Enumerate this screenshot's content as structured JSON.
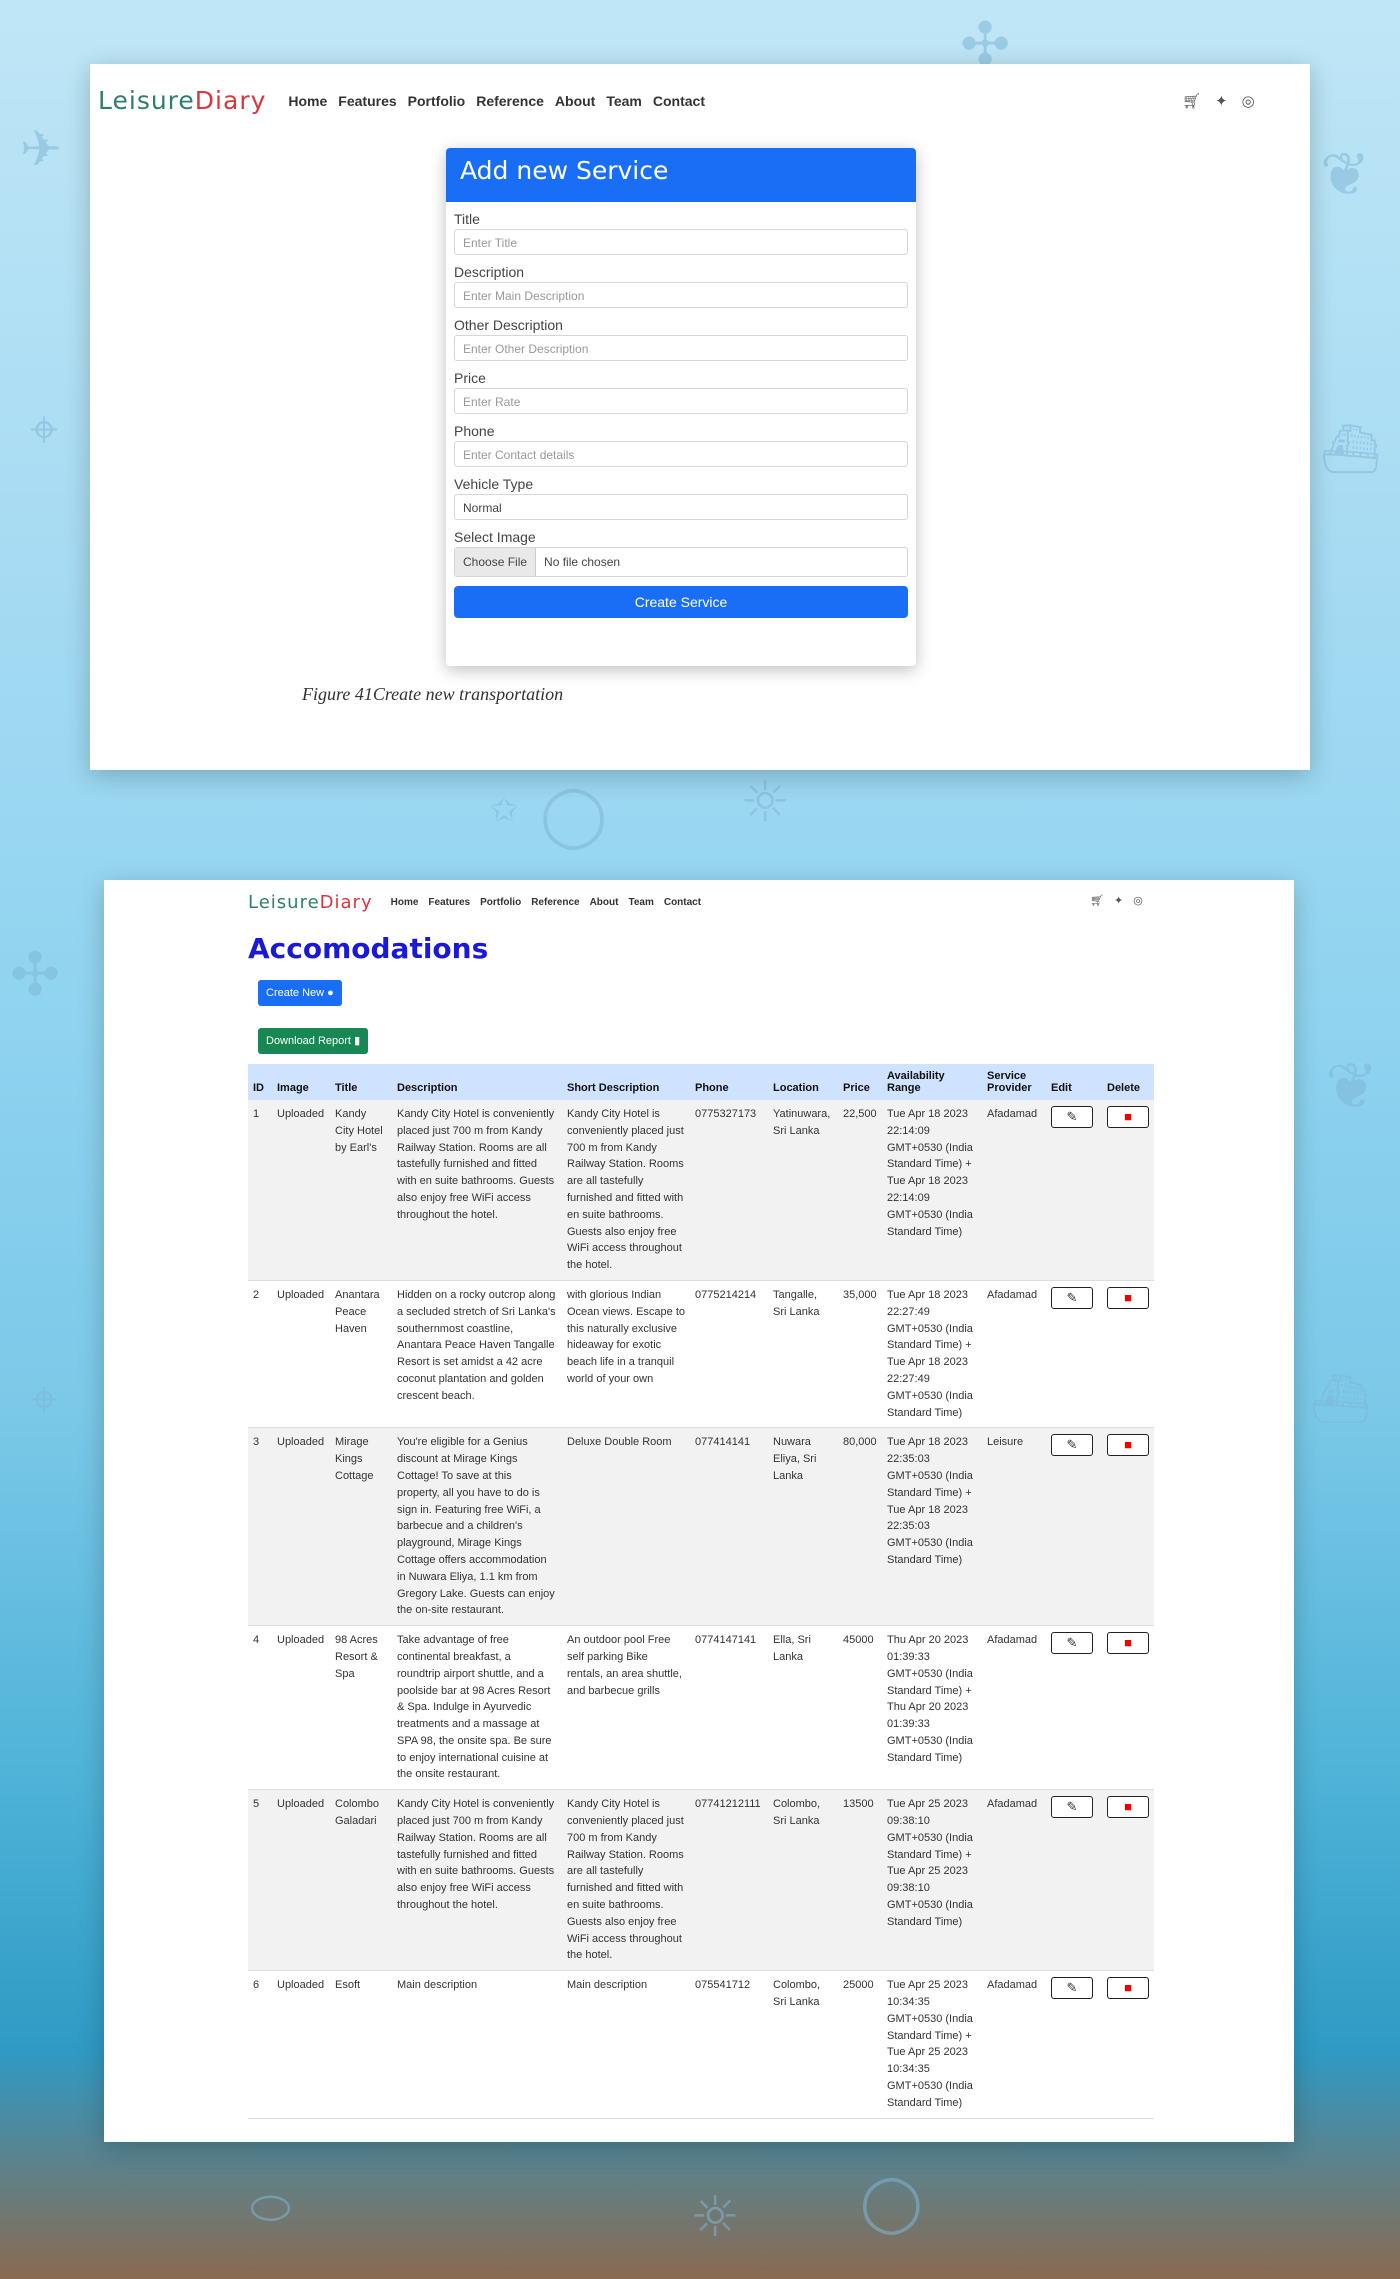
{
  "brand": {
    "part1": "Leisure",
    "part2": "Diary"
  },
  "nav": [
    "Home",
    "Features",
    "Portfolio",
    "Reference",
    "About",
    "Team",
    "Contact"
  ],
  "nav_icons": [
    "cart-icon",
    "twitter-icon",
    "instagram-icon"
  ],
  "form": {
    "title": "Add new Service",
    "fields": [
      {
        "label": "Title",
        "placeholder": "Enter Title"
      },
      {
        "label": "Description",
        "placeholder": "Enter Main Description"
      },
      {
        "label": "Other Description",
        "placeholder": "Enter Other Description"
      },
      {
        "label": "Price",
        "placeholder": "Enter Rate"
      },
      {
        "label": "Phone",
        "placeholder": "Enter Contact details"
      },
      {
        "label": "Vehicle Type",
        "value": "Normal"
      }
    ],
    "image_label": "Select Image",
    "choose_file": "Choose File",
    "no_file": "No file chosen",
    "submit": "Create Service"
  },
  "caption": "Figure 41Create new transportation",
  "accommodations": {
    "title": "Accomodations",
    "create_new": "Create New",
    "download_report": "Download Report",
    "columns": [
      "ID",
      "Image",
      "Title",
      "Description",
      "Short Description",
      "Phone",
      "Location",
      "Price",
      "Availability Range",
      "Service Provider",
      "Edit",
      "Delete"
    ],
    "rows": [
      {
        "id": "1",
        "image": "Uploaded",
        "title": "Kandy City Hotel by Earl's",
        "description": "Kandy City Hotel is conveniently placed just 700 m from Kandy Railway Station. Rooms are all tastefully furnished and fitted with en suite bathrooms. Guests also enjoy free WiFi access throughout the hotel.",
        "short": "Kandy City Hotel is conveniently placed just 700 m from Kandy Railway Station. Rooms are all tastefully furnished and fitted with en suite bathrooms. Guests also enjoy free WiFi access throughout the hotel.",
        "phone": "0775327173",
        "location": "Yatinuwara, Sri Lanka",
        "price": "22,500",
        "range": "Tue Apr 18 2023 22:14:09 GMT+0530 (India Standard Time) + Tue Apr 18 2023 22:14:09 GMT+0530 (India Standard Time)",
        "provider": "Afadamad"
      },
      {
        "id": "2",
        "image": "Uploaded",
        "title": "Anantara Peace Haven",
        "description": "Hidden on a rocky outcrop along a secluded stretch of Sri Lanka's southernmost coastline, Anantara Peace Haven Tangalle Resort is set amidst a 42 acre coconut plantation and golden crescent beach.",
        "short": "with glorious Indian Ocean views. Escape to this naturally exclusive hideaway for exotic beach life in a tranquil world of your own",
        "phone": "0775214214",
        "location": "Tangalle, Sri Lanka",
        "price": "35,000",
        "range": "Tue Apr 18 2023 22:27:49 GMT+0530 (India Standard Time) + Tue Apr 18 2023 22:27:49 GMT+0530 (India Standard Time)",
        "provider": "Afadamad"
      },
      {
        "id": "3",
        "image": "Uploaded",
        "title": "Mirage Kings Cottage",
        "description": "You're eligible for a Genius discount at Mirage Kings Cottage! To save at this property, all you have to do is sign in. Featuring free WiFi, a barbecue and a children's playground, Mirage Kings Cottage offers accommodation in Nuwara Eliya, 1.1 km from Gregory Lake. Guests can enjoy the on-site restaurant.",
        "short": "Deluxe Double Room",
        "phone": "077414141",
        "location": "Nuwara Eliya, Sri Lanka",
        "price": "80,000",
        "range": "Tue Apr 18 2023 22:35:03 GMT+0530 (India Standard Time) + Tue Apr 18 2023 22:35:03 GMT+0530 (India Standard Time)",
        "provider": "Leisure"
      },
      {
        "id": "4",
        "image": "Uploaded",
        "title": "98 Acres Resort & Spa",
        "description": "Take advantage of free continental breakfast, a roundtrip airport shuttle, and a poolside bar at 98 Acres Resort & Spa. Indulge in Ayurvedic treatments and a massage at SPA 98, the onsite spa. Be sure to enjoy international cuisine at the onsite restaurant.",
        "short": "An outdoor pool Free self parking Bike rentals, an area shuttle, and barbecue grills",
        "phone": "0774147141",
        "location": "Ella, Sri Lanka",
        "price": "45000",
        "range": "Thu Apr 20 2023 01:39:33 GMT+0530 (India Standard Time) + Thu Apr 20 2023 01:39:33 GMT+0530 (India Standard Time)",
        "provider": "Afadamad"
      },
      {
        "id": "5",
        "image": "Uploaded",
        "title": "Colombo Galadari",
        "description": "Kandy City Hotel is conveniently placed just 700 m from Kandy Railway Station. Rooms are all tastefully furnished and fitted with en suite bathrooms. Guests also enjoy free WiFi access throughout the hotel.",
        "short": "Kandy City Hotel is conveniently placed just 700 m from Kandy Railway Station. Rooms are all tastefully furnished and fitted with en suite bathrooms. Guests also enjoy free WiFi access throughout the hotel.",
        "phone": "07741212111",
        "location": "Colombo, Sri Lanka",
        "price": "13500",
        "range": "Tue Apr 25 2023 09:38:10 GMT+0530 (India Standard Time) + Tue Apr 25 2023 09:38:10 GMT+0530 (India Standard Time)",
        "provider": "Afadamad"
      },
      {
        "id": "6",
        "image": "Uploaded",
        "title": "Esoft",
        "description": "Main description",
        "short": "Main description",
        "phone": "075541712",
        "location": "Colombo, Sri Lanka",
        "price": "25000",
        "range": "Tue Apr 25 2023 10:34:35 GMT+0530 (India Standard Time) + Tue Apr 25 2023 10:34:35 GMT+0530 (India Standard Time)",
        "provider": "Afadamad"
      }
    ]
  },
  "colors": {
    "primary": "#1a6ef5",
    "success": "#198754",
    "title_blue": "#1a1ad6",
    "danger": "#e00000"
  }
}
